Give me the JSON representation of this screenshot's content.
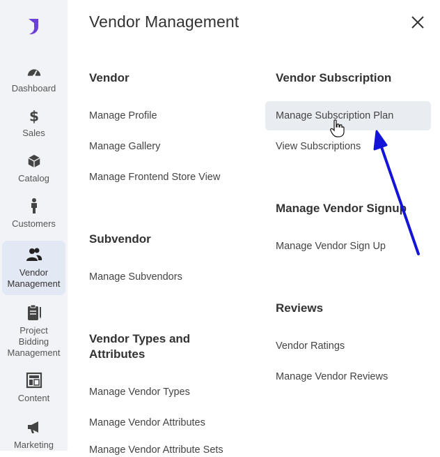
{
  "sidebar": {
    "items": [
      {
        "label": "Dashboard",
        "icon": "dashboard-gauge-icon"
      },
      {
        "label": "Sales",
        "icon": "dollar-icon"
      },
      {
        "label": "Catalog",
        "icon": "box-icon"
      },
      {
        "label": "Customers",
        "icon": "person-icon"
      },
      {
        "label": "Vendor\nManagement",
        "icon": "vendor-users-icon"
      },
      {
        "label": "Project\nBidding\nManagement",
        "icon": "clipboard-icon"
      },
      {
        "label": "Content",
        "icon": "layout-icon"
      },
      {
        "label": "Marketing",
        "icon": "megaphone-icon"
      }
    ]
  },
  "panel": {
    "title": "Vendor Management",
    "left_column": [
      {
        "title": "Vendor",
        "links": [
          "Manage Profile",
          "Manage Gallery",
          "Manage Frontend Store View"
        ]
      },
      {
        "title": "Subvendor",
        "links": [
          "Manage Subvendors"
        ]
      },
      {
        "title": "Vendor Types and\nAttributes",
        "links": [
          "Manage Vendor Types",
          "Manage Vendor Attributes",
          "Manage Vendor Attribute Sets"
        ]
      }
    ],
    "right_column": [
      {
        "title": "Vendor Subscription",
        "links": [
          "Manage Subscription Plan",
          "View Subscriptions"
        ]
      },
      {
        "title": "Manage Vendor Signup",
        "links": [
          "Manage Vendor Sign Up"
        ]
      },
      {
        "title": "Reviews",
        "links": [
          "Vendor Ratings",
          "Manage Vendor Reviews"
        ]
      }
    ]
  },
  "colors": {
    "accent": "#6b3fd8",
    "annotation_arrow": "#1414d8",
    "sidebar_bg": "#f1f3f6",
    "active_bg": "#e2e8f4"
  }
}
